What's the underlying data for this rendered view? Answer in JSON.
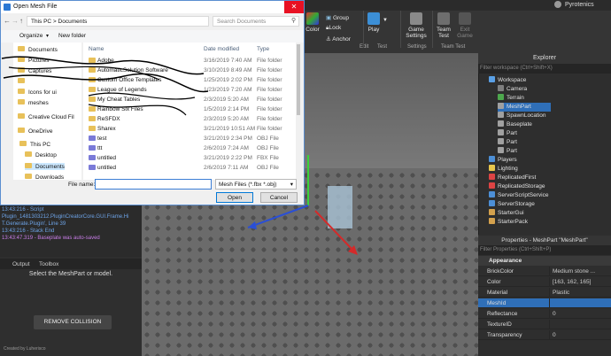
{
  "studio": {
    "username": "Pyrotenics",
    "ribbon": {
      "color_label": "Color",
      "group_label": "Group",
      "lock_label": "Lock",
      "anchor_label": "Anchor",
      "play_label": "Play",
      "game_settings_label": "Game Settings",
      "team_test_label": "Team Test",
      "exit_game_label": "Exit Game",
      "edit_group": "Edit",
      "test_group": "Test",
      "settings_group": "Settings",
      "team_test_group": "Team Test"
    },
    "output": {
      "lines": [
        "13:43:216 - Script",
        "Plugin_1481303212.PluginCreatorCore.GUI.Frame.Hi",
        "T.Generate.Plugin', Line 39",
        "13:43:216 - Stack End",
        "13:43:47.319 - Baseplate was auto-saved"
      ],
      "tabs": [
        "Output",
        "Toolbox"
      ]
    },
    "plugin": {
      "message": "Select the MeshPart or model.",
      "button": "REMOVE COLLISION",
      "credit": "Created by Luherisco"
    },
    "explorer": {
      "title": "Explorer",
      "filter_placeholder": "Filter workspace (Ctrl+Shift+X)",
      "items": [
        {
          "label": "Workspace",
          "indent": 0,
          "color": "#5aa0e6"
        },
        {
          "label": "Camera",
          "indent": 1,
          "color": "#7f7f7f"
        },
        {
          "label": "Terrain",
          "indent": 1,
          "color": "#4da84d"
        },
        {
          "label": "MeshPart",
          "indent": 1,
          "color": "#a0a0a0",
          "selected": true
        },
        {
          "label": "SpawnLocation",
          "indent": 1,
          "color": "#a0a0a0"
        },
        {
          "label": "Baseplate",
          "indent": 1,
          "color": "#a0a0a0"
        },
        {
          "label": "Part",
          "indent": 1,
          "color": "#a0a0a0"
        },
        {
          "label": "Part",
          "indent": 1,
          "color": "#a0a0a0"
        },
        {
          "label": "Part",
          "indent": 1,
          "color": "#a0a0a0"
        },
        {
          "label": "Players",
          "indent": 0,
          "color": "#4d8fd6"
        },
        {
          "label": "Lighting",
          "indent": 0,
          "color": "#e8c64c"
        },
        {
          "label": "ReplicatedFirst",
          "indent": 0,
          "color": "#d44"
        },
        {
          "label": "ReplicatedStorage",
          "indent": 0,
          "color": "#d44"
        },
        {
          "label": "ServerScriptService",
          "indent": 0,
          "color": "#4d8fd6"
        },
        {
          "label": "ServerStorage",
          "indent": 0,
          "color": "#4d8fd6"
        },
        {
          "label": "StarterGui",
          "indent": 0,
          "color": "#d4a14d"
        },
        {
          "label": "StarterPack",
          "indent": 0,
          "color": "#d4a14d"
        }
      ]
    },
    "properties": {
      "title": "Properties - MeshPart \"MeshPart\"",
      "filter_placeholder": "Filter Properties (Ctrl+Shift+P)",
      "section": "Appearance",
      "rows": [
        {
          "name": "BrickColor",
          "value": "Medium stone ..."
        },
        {
          "name": "Color",
          "value": "[163, 162, 165]"
        },
        {
          "name": "Material",
          "value": "Plastic"
        },
        {
          "name": "MeshId",
          "value": ""
        },
        {
          "name": "Reflectance",
          "value": "0"
        },
        {
          "name": "TextureID",
          "value": ""
        },
        {
          "name": "Transparency",
          "value": "0"
        }
      ]
    }
  },
  "dialog": {
    "title": "Open Mesh File",
    "address": "This PC  >  Documents",
    "search_placeholder": "Search Documents",
    "organize": "Organize",
    "new_folder": "New folder",
    "nav_items": [
      "Documents",
      "Pictures",
      "Captures",
      "",
      "Icons for ui",
      "meshes",
      "Creative Cloud Fil",
      "OneDrive",
      "This PC",
      "Desktop",
      "Documents",
      "Downloads"
    ],
    "columns": {
      "name": "Name",
      "date": "Date modified",
      "type": "Type"
    },
    "files": [
      {
        "name": "Adobe",
        "date": "3/16/2019 7:40 AM",
        "type": "File folder",
        "color": "#e8c15a"
      },
      {
        "name": "AutomaticSolution Software",
        "date": "3/10/2019 8:49 AM",
        "type": "File folder",
        "color": "#e8c15a"
      },
      {
        "name": "Custom Office Templates",
        "date": "1/25/2019 2:02 PM",
        "type": "File folder",
        "color": "#e8c15a"
      },
      {
        "name": "League of Legends",
        "date": "1/23/2019 7:20 AM",
        "type": "File folder",
        "color": "#e8c15a"
      },
      {
        "name": "My Cheat Tables",
        "date": "2/3/2019 5:20 AM",
        "type": "File folder",
        "color": "#e8c15a"
      },
      {
        "name": "Rainbow Six Files",
        "date": "1/5/2019 2:14 PM",
        "type": "File folder",
        "color": "#e8c15a"
      },
      {
        "name": "ReSFDX",
        "date": "2/3/2019 5:20 AM",
        "type": "File folder",
        "color": "#e8c15a"
      },
      {
        "name": "Sharex",
        "date": "3/21/2019 10:51 AM",
        "type": "File folder",
        "color": "#e8c15a"
      },
      {
        "name": "test",
        "date": "3/21/2019 2:34 PM",
        "type": "OBJ File",
        "color": "#7a7ad8"
      },
      {
        "name": "ttt",
        "date": "2/6/2019 7:24 AM",
        "type": "OBJ File",
        "color": "#7a7ad8"
      },
      {
        "name": "untitled",
        "date": "3/21/2019 2:22 PM",
        "type": "FBX File",
        "color": "#7a7ad8"
      },
      {
        "name": "untitled",
        "date": "2/6/2019 7:11 AM",
        "type": "OBJ File",
        "color": "#7a7ad8"
      }
    ],
    "file_name_label": "File name:",
    "file_name_value": "",
    "file_type": "Mesh Files (*.fbx *.obj)",
    "open_button": "Open",
    "cancel_button": "Cancel"
  }
}
